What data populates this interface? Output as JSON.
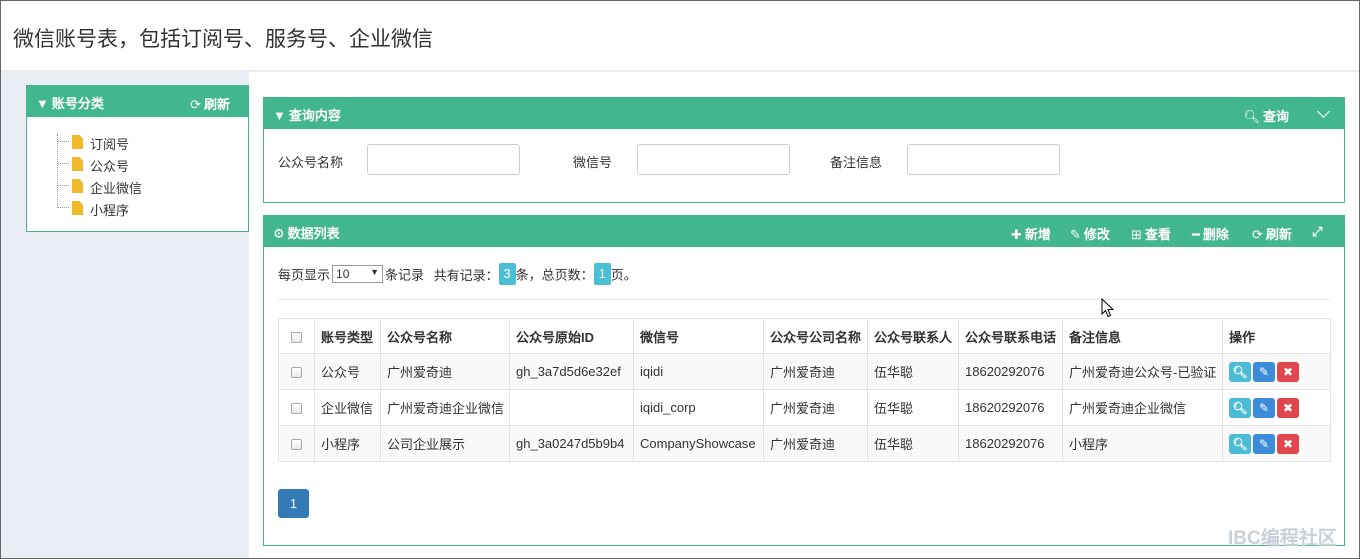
{
  "page": {
    "title": "微信账号表，包括订阅号、服务号、企业微信"
  },
  "colors": {
    "panel_green": "#42b68f",
    "badge": "#4bbfd5",
    "page_btn": "#337ab7",
    "view_btn": "#4cbbd5",
    "edit_btn": "#3c8dd9",
    "delete_btn": "#e0474c"
  },
  "tree": {
    "icon_title": "filter-icon",
    "title": "账号分类",
    "refresh_icon": "refresh-icon",
    "refresh_label": "刷新",
    "items": [
      {
        "label": "订阅号",
        "icon": "file-icon"
      },
      {
        "label": "公众号",
        "icon": "file-icon"
      },
      {
        "label": "企业微信",
        "icon": "file-icon"
      },
      {
        "label": "小程序",
        "icon": "file-icon"
      }
    ]
  },
  "query": {
    "title": "查询内容",
    "search_label": "查询",
    "fields": [
      {
        "label": "公众号名称",
        "value": ""
      },
      {
        "label": "微信号",
        "value": ""
      },
      {
        "label": "备注信息",
        "value": ""
      }
    ]
  },
  "list": {
    "title": "数据列表",
    "toolbar": {
      "add_label": "新增",
      "edit_label": "修改",
      "view_label": "查看",
      "delete_label": "删除",
      "refresh_label": "刷新"
    },
    "pager": {
      "prefix": "每页显示",
      "page_size": "10",
      "suffix": "条记录",
      "total_label": "共有记录：",
      "total": "3",
      "total_unit": "条，总页数：",
      "pages": "1",
      "pages_unit": "页。",
      "current_page": "1"
    },
    "columns": [
      "账号类型",
      "公众号名称",
      "公众号原始ID",
      "微信号",
      "公众号公司名称",
      "公众号联系人",
      "公众号联系电话",
      "备注信息",
      "操作"
    ],
    "rows": [
      [
        "公众号",
        "广州爱奇迪",
        "gh_3a7d5d6e32ef",
        "iqidi",
        "广州爱奇迪",
        "伍华聪",
        "18620292076",
        "广州爱奇迪公众号-已验证"
      ],
      [
        "企业微信",
        "广州爱奇迪企业微信",
        "",
        "iqidi_corp",
        "广州爱奇迪",
        "伍华聪",
        "18620292076",
        "广州爱奇迪企业微信"
      ],
      [
        "小程序",
        "公司企业展示",
        "gh_3a0247d5b9b4",
        "CompanyShowcase",
        "广州爱奇迪",
        "伍华聪",
        "18620292076",
        "小程序"
      ]
    ]
  },
  "watermark": "IBC编程社区"
}
